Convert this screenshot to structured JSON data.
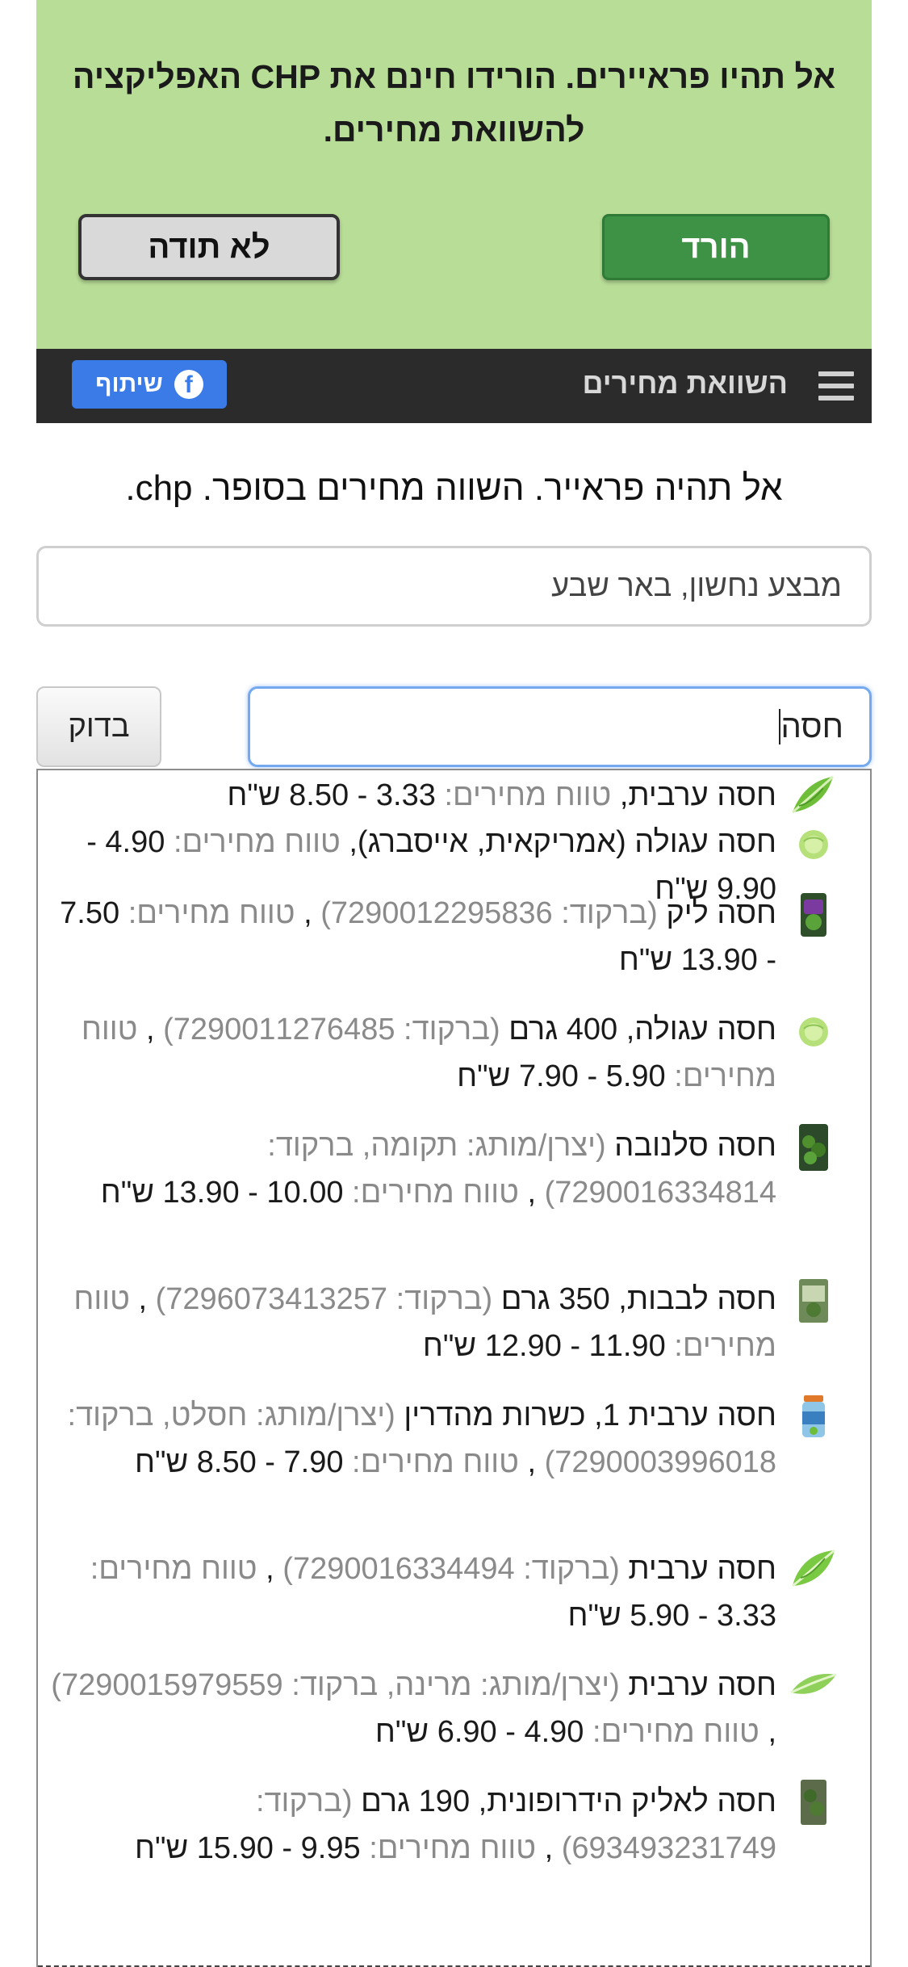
{
  "promo": {
    "text": "אל תהיו פראיירים. הורידו חינם את CHP האפליקציה להשוואת מחירים.",
    "download_label": "הורד",
    "decline_label": "לא תודה"
  },
  "navbar": {
    "title": "השוואת מחירים",
    "share_label": "שיתוף",
    "menu_icon": "hamburger-menu-icon",
    "share_icon": "facebook-icon"
  },
  "headline": "אל תהיה פראייר. השווה מחירים בסופר. chp.",
  "location": {
    "value": "מבצע נחשון, באר שבע"
  },
  "search": {
    "value": "חסה",
    "button_label": "בדוק"
  },
  "colors": {
    "promo_bg": "#b8dd97",
    "download_bg": "#3e9245",
    "navbar_bg": "#2b2b2b",
    "share_bg": "#3b7be8",
    "muted_text": "#8a8a8a"
  },
  "suggestions": [
    {
      "name": "חסה ערבית,",
      "price_label": "טווח מחירים:",
      "price": "3.33 - 8.50 ש\"ח",
      "icon": "romaine-lettuce-icon"
    },
    {
      "name": "חסה עגולה (אמריקאית, אייסברג),",
      "price_label": "טווח מחירים:",
      "price": "4.90 - 9.90 ש\"ח",
      "icon": "iceberg-lettuce-icon"
    },
    {
      "name": "חסה ליק",
      "barcode_label": "(ברקוד:",
      "barcode": "7290012295836)",
      "separator": ",",
      "price_label": "טווח מחירים:",
      "price": "7.50 - 13.90 ש\"ח",
      "icon": "lettuce-bag-icon"
    },
    {
      "name": "חסה עגולה, 400 גרם",
      "barcode_label": "(ברקוד:",
      "barcode": "7290011276485)",
      "separator": ",",
      "price_label": "טווח מחירים:",
      "price": "5.90 - 7.90 ש\"ח",
      "icon": "iceberg-lettuce-icon"
    },
    {
      "name": "חסה סלנובה",
      "meta": "(יצרן/מותג: תקומה, ברקוד:",
      "barcode": "7290016334814)",
      "separator": ",",
      "price_label": "טווח מחירים:",
      "price": "10.00 - 13.90 ש\"ח",
      "icon": "lettuce-bag-icon"
    },
    {
      "name": "חסה לבבות, 350 גרם",
      "barcode_label": "(ברקוד:",
      "barcode": "7296073413257)",
      "separator": ",",
      "price_label": "טווח מחירים:",
      "price": "11.90 - 12.90 ש\"ח",
      "icon": "lettuce-pack-icon"
    },
    {
      "name": "חסה ערבית 1, כשרות מהדרין",
      "meta": "(יצרן/מותג: חסלט, ברקוד:",
      "barcode": "7290003996018)",
      "separator": ",",
      "price_label": "טווח מחירים:",
      "price": "7.90 - 8.50 ש\"ח",
      "icon": "lettuce-jar-icon"
    },
    {
      "name": "חסה ערבית",
      "barcode_label": "(ברקוד:",
      "barcode": "7290016334494)",
      "separator": ",",
      "price_label": "טווח מחירים:",
      "price": "3.33 - 5.90 ש\"ח",
      "icon": "romaine-lettuce-icon"
    },
    {
      "name": "חסה ערבית",
      "meta": "(יצרן/מותג: מרינה, ברקוד:",
      "barcode": "7290015979559)",
      "separator": ",",
      "price_label": "טווח מחירים:",
      "price": "4.90 - 6.90 ש\"ח",
      "icon": "romaine-lettuce-icon"
    },
    {
      "name": "חסה לאליק הידרופונית, 190 גרם",
      "barcode_label": "(ברקוד:",
      "barcode": "693493231749)",
      "separator": ",",
      "price_label": "טווח מחירים:",
      "price": "9.95 - 15.90 ש\"ח",
      "icon": "lettuce-pack-icon"
    }
  ]
}
